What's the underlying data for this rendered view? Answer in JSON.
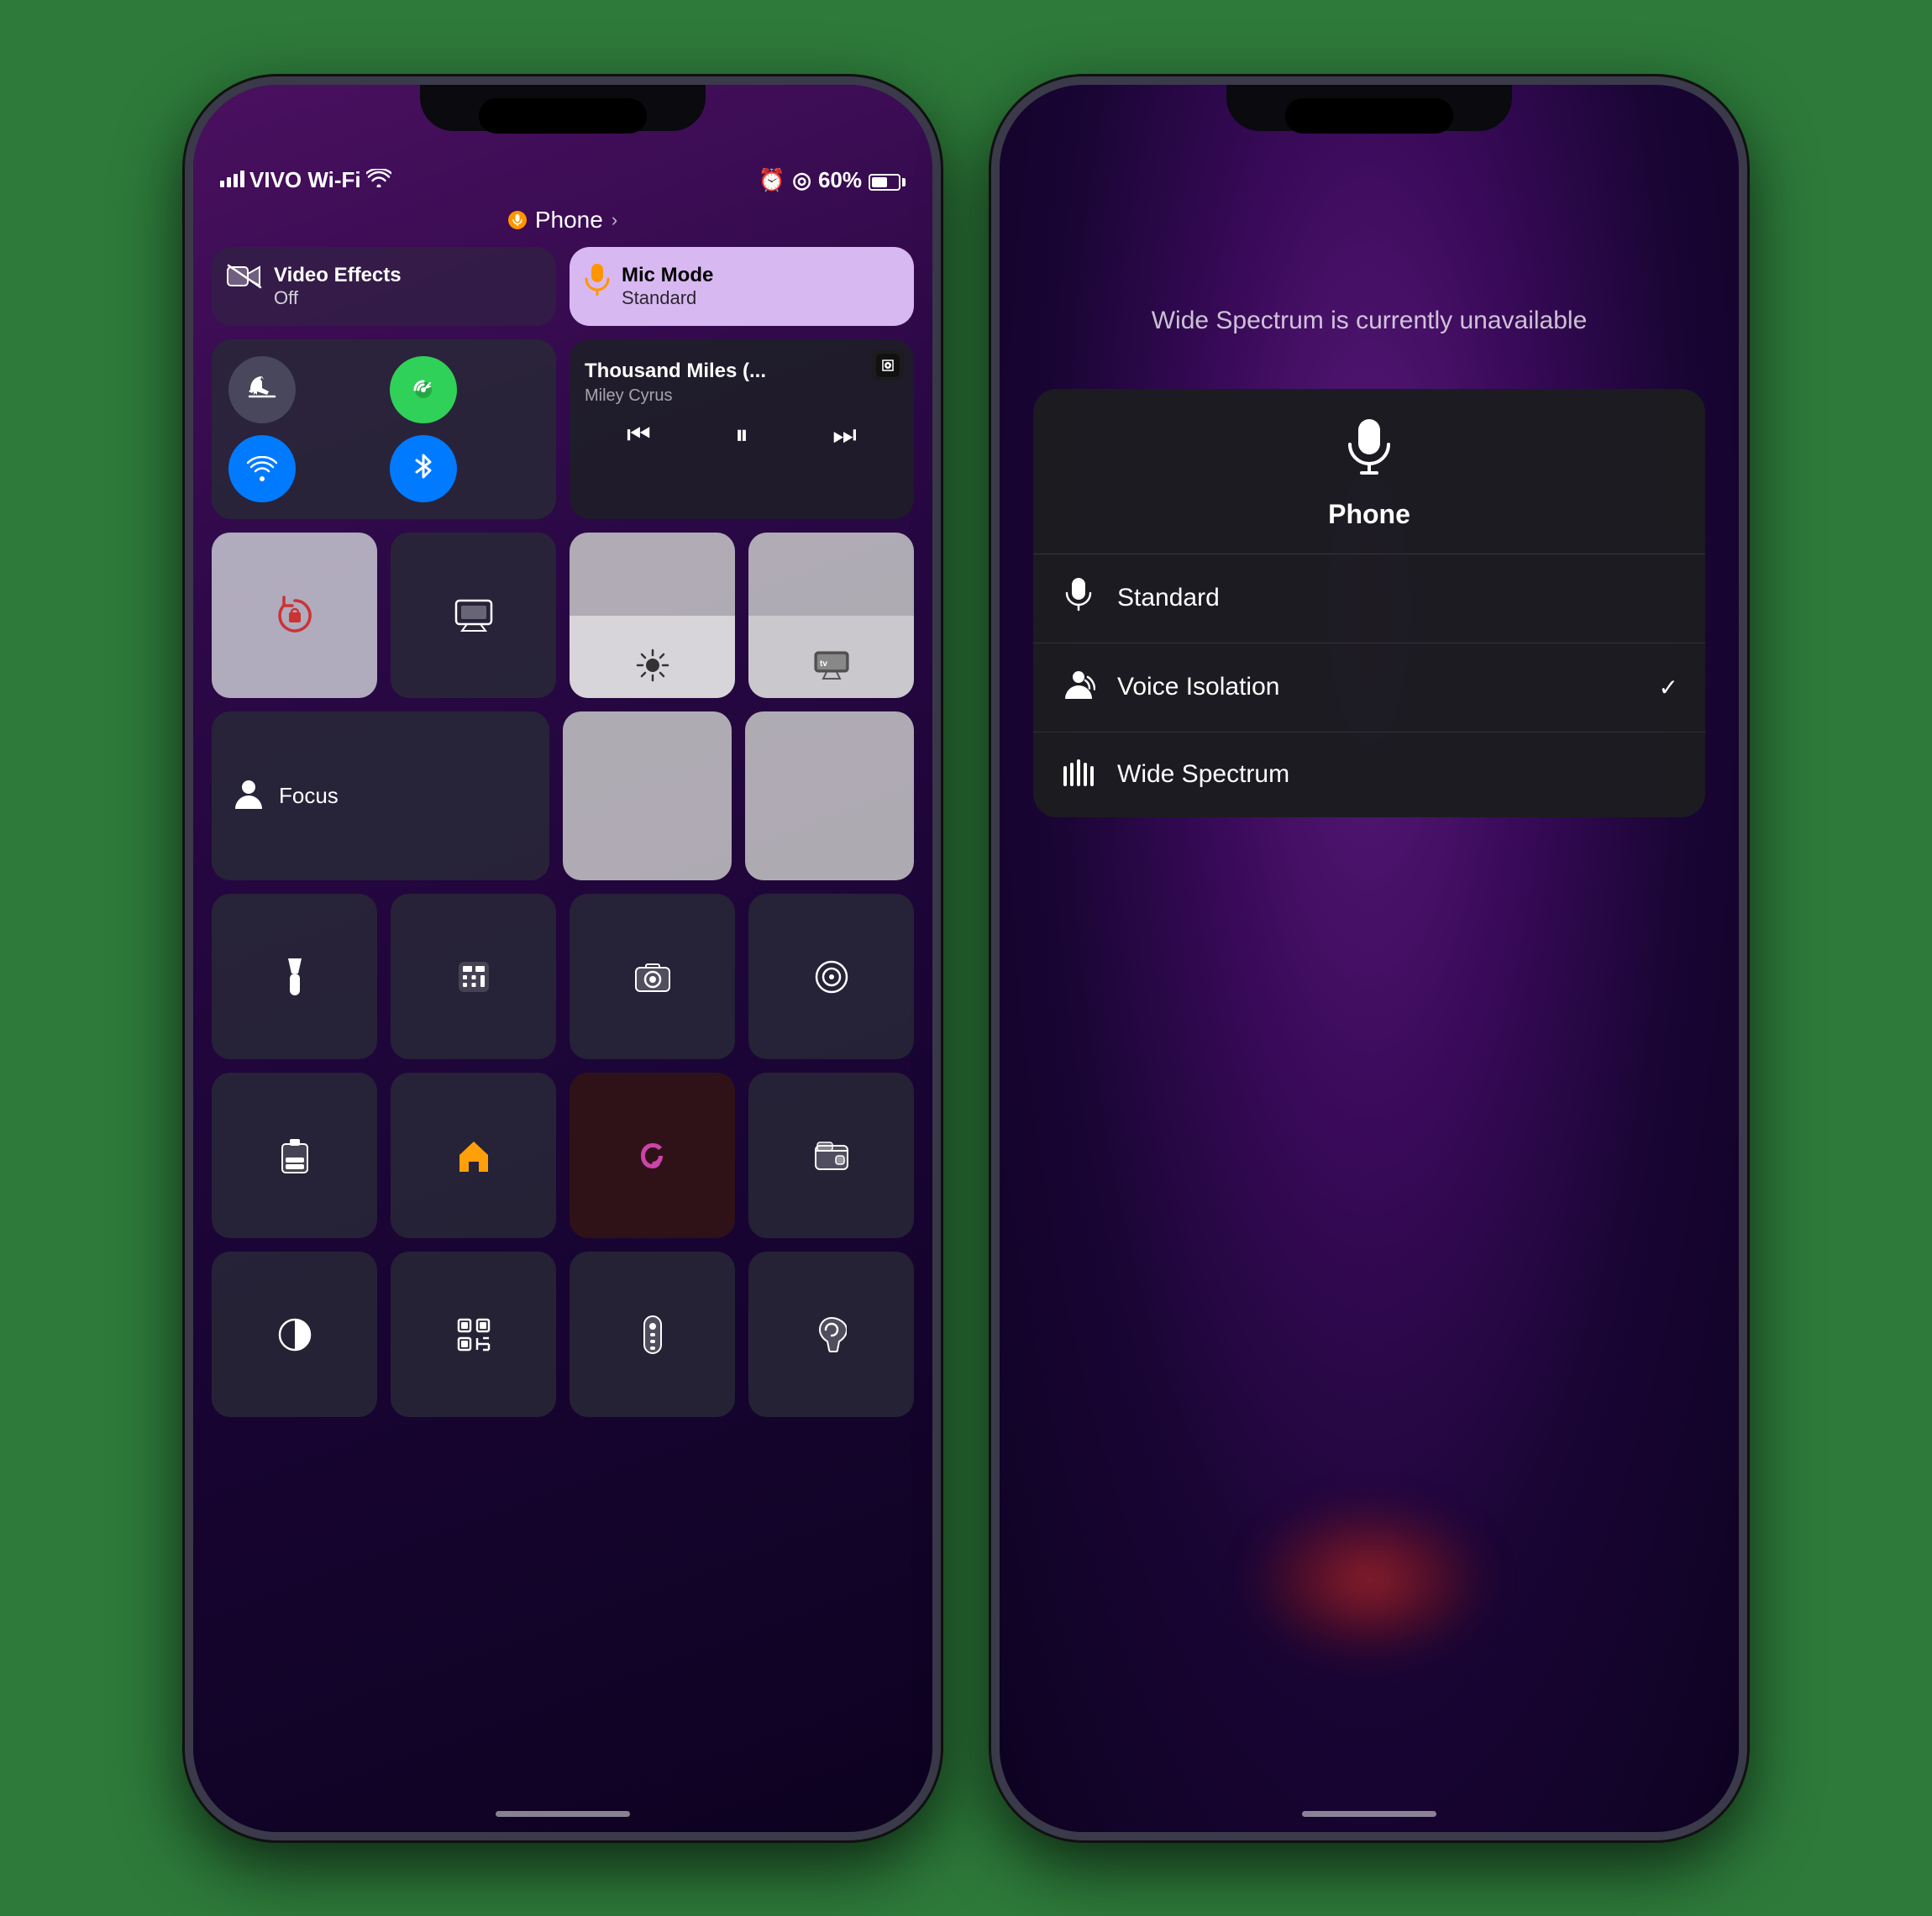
{
  "phone1": {
    "dynamic_island": "dynamic-island",
    "app_indicator": {
      "label": "Phone",
      "chevron": "›"
    },
    "status_bar": {
      "carrier": "VIVO Wi-Fi",
      "wifi": "wifi",
      "alarm": "⏰",
      "battery_pct": "60%"
    },
    "video_effects": {
      "title": "Video Effects",
      "subtitle": "Off"
    },
    "mic_mode": {
      "title": "Mic Mode",
      "subtitle": "Standard"
    },
    "media": {
      "title": "Thousand Miles (...",
      "artist": "Miley Cyrus",
      "app": "tv"
    },
    "network_buttons": [
      {
        "id": "airplane",
        "icon": "✈",
        "color": "gray"
      },
      {
        "id": "mobile",
        "icon": "📶",
        "color": "green"
      },
      {
        "id": "wifi",
        "icon": "wifi",
        "color": "blue"
      },
      {
        "id": "bluetooth",
        "icon": "bluetooth",
        "color": "blue"
      }
    ],
    "controls": {
      "lock": "🔒",
      "screen_mirror": "mirror",
      "brightness": "brightness",
      "appletv": "appletv",
      "focus": "Focus",
      "flashlight": "flashlight",
      "calculator": "calculator",
      "camera": "camera",
      "scan": "scan",
      "battery_widget": "battery",
      "home": "home",
      "shazam": "shazam",
      "wallet": "wallet",
      "contrast": "contrast",
      "qr": "qr",
      "remote": "remote",
      "ear": "ear"
    }
  },
  "phone2": {
    "unavailable_msg": "Wide Spectrum is currently unavailable",
    "picker": {
      "title": "Phone",
      "icon": "mic",
      "options": [
        {
          "label": "Standard",
          "icon": "mic",
          "checked": false
        },
        {
          "label": "Voice Isolation",
          "icon": "voice_isolation",
          "checked": true
        },
        {
          "label": "Wide Spectrum",
          "icon": "wide_spectrum",
          "checked": false
        }
      ]
    }
  }
}
